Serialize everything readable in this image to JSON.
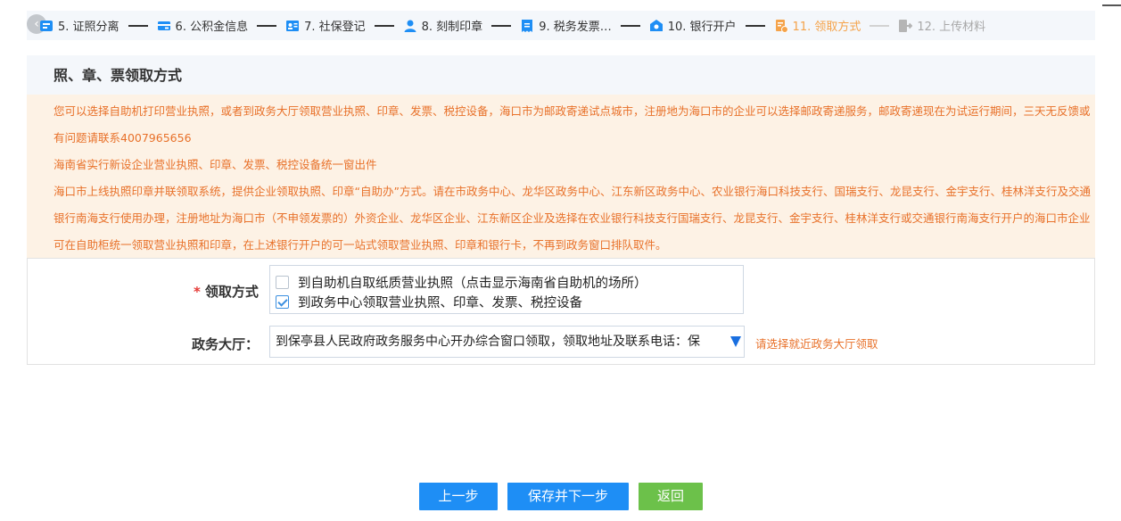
{
  "steps": [
    {
      "label": "5. 证照分离",
      "icon": "license-icon",
      "state": "done"
    },
    {
      "label": "6. 公积金信息",
      "icon": "card-icon",
      "state": "done"
    },
    {
      "label": "7. 社保登记",
      "icon": "id-card-icon",
      "state": "done"
    },
    {
      "label": "8. 刻制印章",
      "icon": "user-icon",
      "state": "done"
    },
    {
      "label": "9. 税务发票…",
      "icon": "tax-icon",
      "state": "done"
    },
    {
      "label": "10. 银行开户",
      "icon": "bank-icon",
      "state": "done"
    },
    {
      "label": "11. 领取方式",
      "icon": "receipt-icon",
      "state": "active"
    },
    {
      "label": "12. 上传材料",
      "icon": "exit-icon",
      "state": "disabled"
    }
  ],
  "colors": {
    "active_step": "#f5a34a",
    "notice_text": "#e8712a",
    "notice_bg": "#fdf2e5",
    "primary": "#1e8ef5",
    "success": "#6cc14a"
  },
  "panel": {
    "title": "照、章、票领取方式",
    "notices": [
      "您可以选择自助机打印营业执照，或者到政务大厅领取营业执照、印章、发票、税控设备，海口市为邮政寄递试点城市，注册地为海口市的企业可以选择邮政寄递服务，邮政寄递现在为试运行期间，三天无反馈或有问题请联系4007965656",
      "海南省实行新设企业营业执照、印章、发票、税控设备统一窗出件",
      "海口市上线执照印章并联领取系统，提供企业领取执照、印章“自助办”方式。请在市政务中心、龙华区政务中心、江东新区政务中心、农业银行海口科技支行、国瑞支行、龙昆支行、金宇支行、桂林洋支行及交通银行南海支行使用办理，注册地址为海口市（不申领发票的）外资企业、龙华区企业、江东新区企业及选择在农业银行科技支行国瑞支行、龙昆支行、金宇支行、桂林洋支行或交通银行南海支行开户的海口市企业可在自助柜统一领取营业执照和印章，在上述银行开户的可一站式领取营业执照、印章和银行卡，不再到政务窗口排队取件。"
    ]
  },
  "form": {
    "pickup_label": "领取方式",
    "required_mark": "*",
    "options": [
      {
        "label": "到自助机自取纸质营业执照（点击显示海南省自助机的场所）",
        "checked": false
      },
      {
        "label": "到政务中心领取营业执照、印章、发票、税控设备",
        "checked": true
      }
    ],
    "hall_label": "政务大厅：",
    "hall_value": "到保亭县人民政府政务服务中心开办综合窗口领取，领取地址及联系电话：保",
    "hall_hint": "请选择就近政务大厅领取"
  },
  "buttons": {
    "prev": "上一步",
    "save_next": "保存并下一步",
    "back": "返回"
  }
}
